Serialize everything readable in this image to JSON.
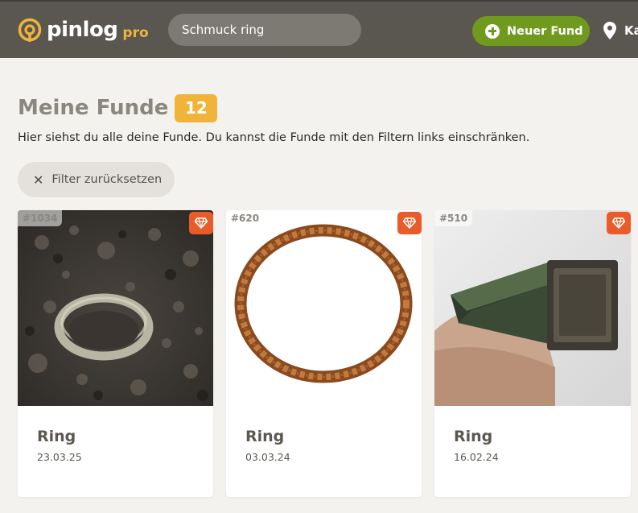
{
  "header": {
    "logo_text": "pinlog",
    "logo_pro": "pro",
    "search_value": "Schmuck ring",
    "new_button_label": "Neuer Fund",
    "map_label": "Karte"
  },
  "main": {
    "title": "Meine Funde",
    "count": "12",
    "subtitle": "Hier siehst du alle deine Funde. Du kannst die Funde mit den Filtern links einschränken.",
    "reset_label": "Filter zurücksetzen"
  },
  "cards": [
    {
      "id": "#1034",
      "title": "Ring",
      "date": "23.03.25"
    },
    {
      "id": "#620",
      "title": "Ring",
      "date": "03.03.24"
    },
    {
      "id": "#510",
      "title": "Ring",
      "date": "16.02.24"
    }
  ],
  "colors": {
    "header_bg": "#5a5751",
    "accent_yellow": "#f0b43a",
    "accent_green": "#6f9a1e",
    "gem_orange": "#e95b2a"
  },
  "icons": [
    "pinlog-logo-icon",
    "plus-circle-icon",
    "map-pin-icon",
    "close-icon",
    "gem-icon"
  ]
}
